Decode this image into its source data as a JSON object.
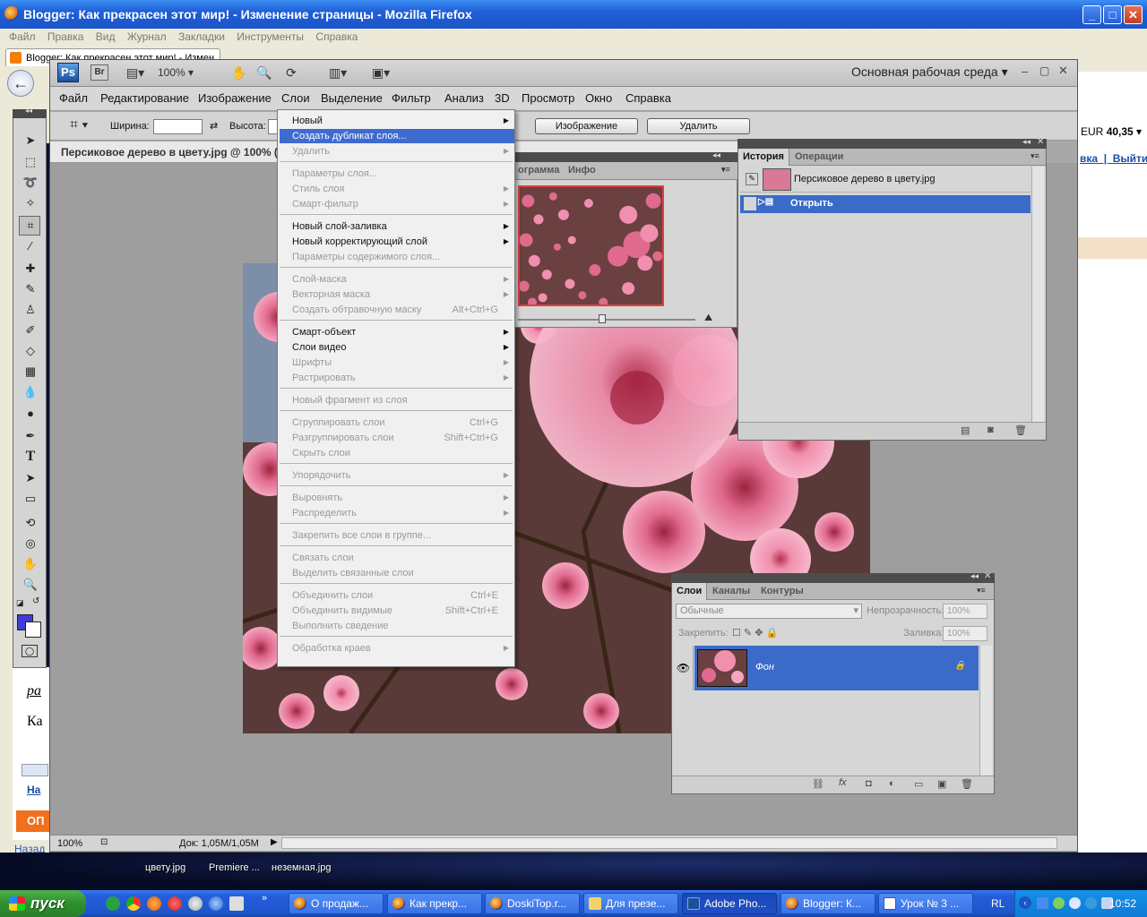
{
  "firefox": {
    "title": "Blogger: Как прекрасен этот мир! - Изменение страницы - Mozilla Firefox",
    "menu": [
      "Файл",
      "Правка",
      "Вид",
      "Журнал",
      "Закладки",
      "Инструменты",
      "Справка"
    ],
    "tab_label": "Blogger: Как прекрасен этот мир! - Измен...",
    "eur_label": "EUR",
    "eur_value": "40,35",
    "links": [
      "вка",
      "Выйти"
    ],
    "status_link": "Назад",
    "blog_fragments": [
      "ра",
      "Ка",
      "На",
      "ОП"
    ]
  },
  "photoshop": {
    "logo": "Ps",
    "bridge": "Br",
    "zoom_value": "100%",
    "workspace": "Основная рабочая среда",
    "menu": [
      "Файл",
      "Редактирование",
      "Изображение",
      "Слои",
      "Выделение",
      "Фильтр",
      "Анализ",
      "3D",
      "Просмотр",
      "Окно",
      "Справка"
    ],
    "options": {
      "width_label": "Ширина:",
      "height_label": "Высота:",
      "image_button": "Изображение",
      "delete_button": "Удалить"
    },
    "doc_tab": "Персиковое дерево в цвету.jpg @ 100% (",
    "status": {
      "zoom": "100%",
      "doc_info": "Док: 1,05M/1,05M"
    }
  },
  "layer_menu": {
    "items": [
      {
        "label": "Новый",
        "enabled": true,
        "submenu": true,
        "shortcut": ""
      },
      {
        "label": "Создать дубликат слоя...",
        "enabled": true,
        "selected": true,
        "submenu": false,
        "shortcut": ""
      },
      {
        "label": "Удалить",
        "enabled": false,
        "submenu": true,
        "shortcut": ""
      },
      {
        "sep": true
      },
      {
        "label": "Параметры слоя...",
        "enabled": false,
        "submenu": false,
        "shortcut": ""
      },
      {
        "label": "Стиль слоя",
        "enabled": false,
        "submenu": true,
        "shortcut": ""
      },
      {
        "label": "Смарт-фильтр",
        "enabled": false,
        "submenu": true,
        "shortcut": ""
      },
      {
        "sep": true
      },
      {
        "label": "Новый слой-заливка",
        "enabled": true,
        "submenu": true,
        "shortcut": ""
      },
      {
        "label": "Новый корректирующий слой",
        "enabled": true,
        "submenu": true,
        "shortcut": ""
      },
      {
        "label": "Параметры содержимого слоя...",
        "enabled": false,
        "submenu": false,
        "shortcut": ""
      },
      {
        "sep": true
      },
      {
        "label": "Слой-маска",
        "enabled": false,
        "submenu": true,
        "shortcut": ""
      },
      {
        "label": "Векторная маска",
        "enabled": false,
        "submenu": true,
        "shortcut": ""
      },
      {
        "label": "Создать обтравочную маску",
        "enabled": false,
        "submenu": false,
        "shortcut": "Alt+Ctrl+G"
      },
      {
        "sep": true
      },
      {
        "label": "Смарт-объект",
        "enabled": true,
        "submenu": true,
        "shortcut": ""
      },
      {
        "label": "Слои видео",
        "enabled": true,
        "submenu": true,
        "shortcut": ""
      },
      {
        "label": "Шрифты",
        "enabled": false,
        "submenu": true,
        "shortcut": ""
      },
      {
        "label": "Растрировать",
        "enabled": false,
        "submenu": true,
        "shortcut": ""
      },
      {
        "sep": true
      },
      {
        "label": "Новый фрагмент из слоя",
        "enabled": false,
        "submenu": false,
        "shortcut": ""
      },
      {
        "sep": true
      },
      {
        "label": "Сгруппировать слои",
        "enabled": false,
        "submenu": false,
        "shortcut": "Ctrl+G"
      },
      {
        "label": "Разгруппировать слои",
        "enabled": false,
        "submenu": false,
        "shortcut": "Shift+Ctrl+G"
      },
      {
        "label": "Скрыть слои",
        "enabled": false,
        "submenu": false,
        "shortcut": ""
      },
      {
        "sep": true
      },
      {
        "label": "Упорядочить",
        "enabled": false,
        "submenu": true,
        "shortcut": ""
      },
      {
        "sep": true
      },
      {
        "label": "Выровнять",
        "enabled": false,
        "submenu": true,
        "shortcut": ""
      },
      {
        "label": "Распределить",
        "enabled": false,
        "submenu": true,
        "shortcut": ""
      },
      {
        "sep": true
      },
      {
        "label": "Закрепить все слои в группе...",
        "enabled": false,
        "submenu": false,
        "shortcut": ""
      },
      {
        "sep": true
      },
      {
        "label": "Связать слои",
        "enabled": false,
        "submenu": false,
        "shortcut": ""
      },
      {
        "label": "Выделить связанные слои",
        "enabled": false,
        "submenu": false,
        "shortcut": ""
      },
      {
        "sep": true
      },
      {
        "label": "Объединить слои",
        "enabled": false,
        "submenu": false,
        "shortcut": "Ctrl+E"
      },
      {
        "label": "Объединить видимые",
        "enabled": false,
        "submenu": false,
        "shortcut": "Shift+Ctrl+E"
      },
      {
        "label": "Выполнить сведение",
        "enabled": false,
        "submenu": false,
        "shortcut": ""
      },
      {
        "sep": true
      },
      {
        "label": "Обработка краев",
        "enabled": false,
        "submenu": true,
        "shortcut": ""
      }
    ]
  },
  "navigator": {
    "tabs": [
      "ограмма",
      "Инфо"
    ]
  },
  "history": {
    "tabs": [
      "История",
      "Операции"
    ],
    "snapshot": "Персиковое дерево в цвету.jpg",
    "step": "Открыть"
  },
  "layers_panel": {
    "tabs": [
      "Слои",
      "Каналы",
      "Контуры"
    ],
    "blend_mode": "Обычные",
    "opacity_label": "Непрозрачность:",
    "opacity_value": "100%",
    "lock_label": "Закрепить:",
    "fill_label": "Заливка:",
    "fill_value": "100%",
    "layer_name": "Фон"
  },
  "desktop": {
    "icons": [
      "цветy.jpg",
      "Premiere ...",
      "неземная.jpg"
    ]
  },
  "taskbar": {
    "start": "пуск",
    "buttons": [
      "О продаж...",
      "Как прекр...",
      "DoskiTop.r...",
      "Для презе...",
      "Adobe Pho...",
      "Blogger: К...",
      "Урок № 3 ..."
    ],
    "lang": "RL",
    "clock": "10:52"
  },
  "colors": {
    "xp_blue": "#245edb",
    "selection_blue": "#3e6bd0",
    "foreground": "#3c3cd8",
    "blossom_pink": "#e8799a"
  }
}
